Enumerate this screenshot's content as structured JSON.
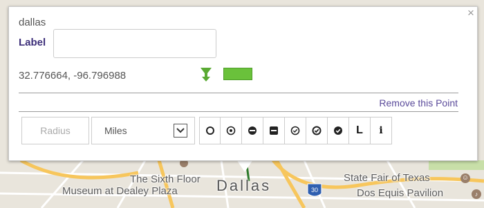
{
  "popup": {
    "place_name": "dallas",
    "label_caption": "Label",
    "label_value": "",
    "coordinates": "32.776664, -96.796988",
    "pin_icon": "green-arrow-pin-icon",
    "marker_color": "#6ac13b",
    "remove_label": "Remove this Point",
    "close_glyph": "×"
  },
  "toolbar": {
    "radius_placeholder": "Radius",
    "radius_value": "",
    "unit_selected": "Miles",
    "shape_tools": [
      {
        "icon": "open-circle-icon"
      },
      {
        "icon": "circle-dot-icon"
      },
      {
        "icon": "filled-circle-minus-icon"
      },
      {
        "icon": "filled-square-minus-icon"
      },
      {
        "icon": "circle-check-outline-icon"
      },
      {
        "icon": "circle-check-icon"
      },
      {
        "icon": "filled-circle-check-icon"
      }
    ],
    "label_tool": "L",
    "info_tool": "i"
  },
  "map": {
    "labels": {
      "sixth_floor_line1": "The Sixth Floor",
      "sixth_floor_line2": "Museum at Dealey Plaza",
      "city": "Dallas",
      "fair": "State Fair of Texas",
      "dos_equis": "Dos Equis Pavilion",
      "highway_shield": "30"
    },
    "colors": {
      "land": "#e9e5dc",
      "highway": "#f7c65c",
      "road": "#ffffff",
      "park": "#c8dfa8"
    }
  }
}
